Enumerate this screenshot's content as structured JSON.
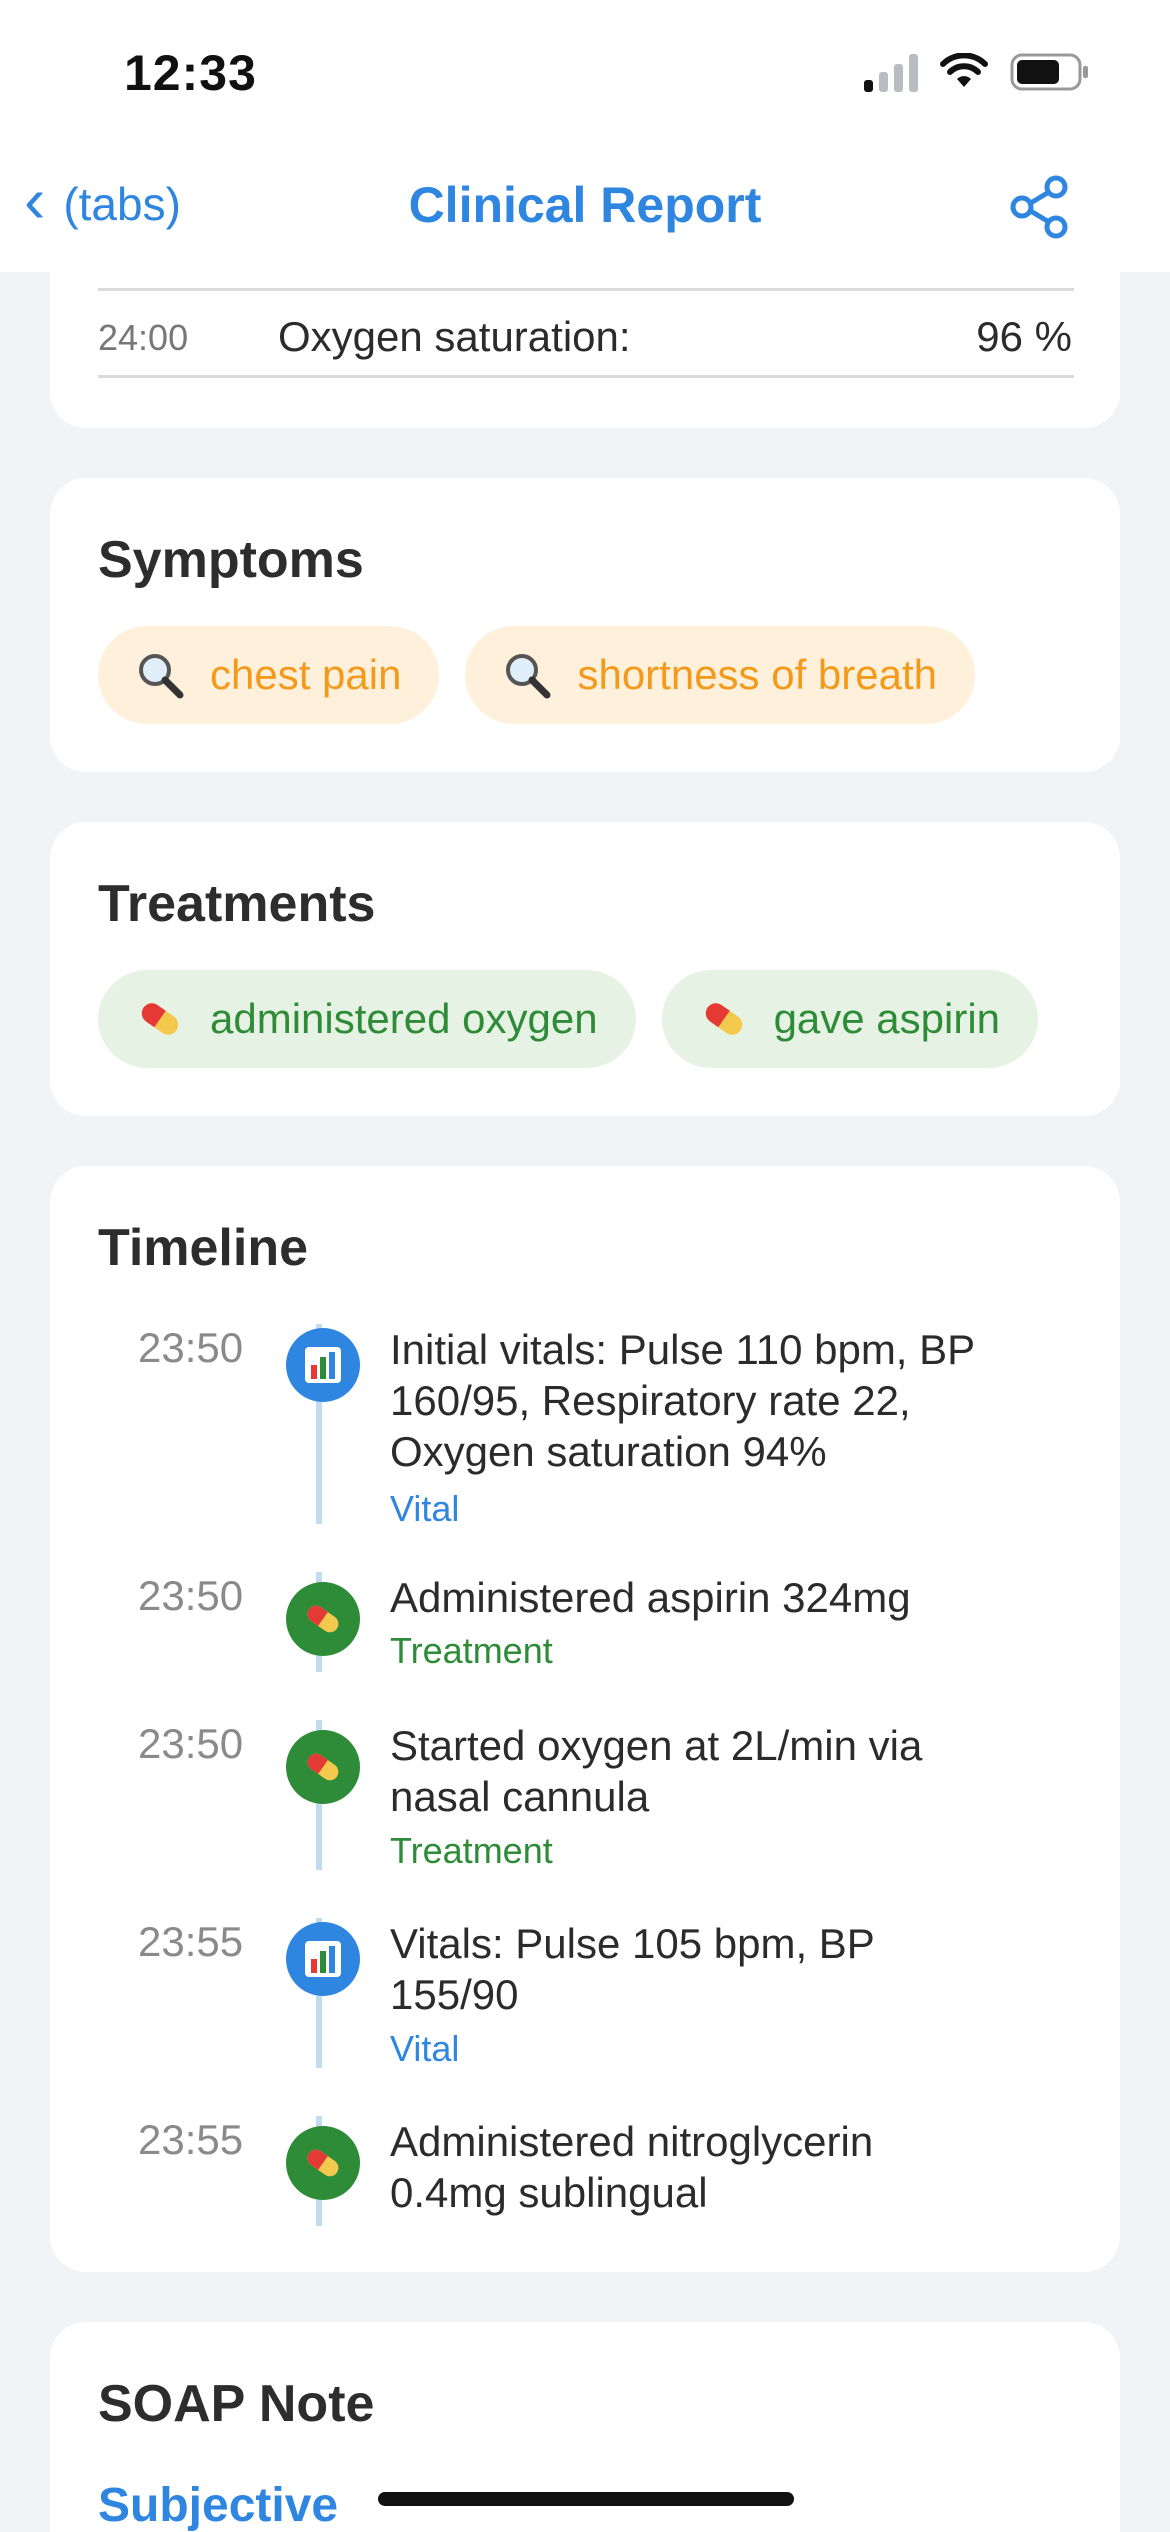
{
  "status_bar": {
    "time": "12:33"
  },
  "nav": {
    "back_label": "(tabs)",
    "title": "Clinical Report"
  },
  "vitals": {
    "time": "24:00",
    "label": "Oxygen saturation:",
    "value": "96 %"
  },
  "symptoms": {
    "title": "Symptoms",
    "items": [
      {
        "label": "chest pain",
        "icon": "magnifier-icon"
      },
      {
        "label": "shortness of breath",
        "icon": "magnifier-icon"
      }
    ]
  },
  "treatments": {
    "title": "Treatments",
    "items": [
      {
        "label": "administered oxygen",
        "icon": "pill-icon"
      },
      {
        "label": "gave aspirin",
        "icon": "pill-icon"
      }
    ]
  },
  "timeline": {
    "title": "Timeline",
    "events": [
      {
        "time": "23:50",
        "lines": [
          "Initial vitals: Pulse 110 bpm, BP",
          "160/95, Respiratory rate 22,",
          "Oxygen saturation 94%"
        ],
        "tag": "Vital",
        "icon": "chart-icon"
      },
      {
        "time": "23:50",
        "lines": [
          "Administered aspirin 324mg"
        ],
        "tag": "Treatment",
        "icon": "pill-icon"
      },
      {
        "time": "23:50",
        "lines": [
          "Started oxygen at 2L/min via",
          "nasal cannula"
        ],
        "tag": "Treatment",
        "icon": "pill-icon"
      },
      {
        "time": "23:55",
        "lines": [
          "Vitals: Pulse 105 bpm, BP",
          "155/90"
        ],
        "tag": "Vital",
        "icon": "chart-icon"
      },
      {
        "time": "23:55",
        "lines": [
          "Administered nitroglycerin",
          "0.4mg sublingual"
        ],
        "tag": "",
        "icon": "pill-icon"
      }
    ]
  },
  "soap": {
    "title": "SOAP Note",
    "subjective_label": "Subjective"
  },
  "colors": {
    "accent": "#2f86e0",
    "treatment": "#2e8b37",
    "symptom": "#f39a1b"
  }
}
